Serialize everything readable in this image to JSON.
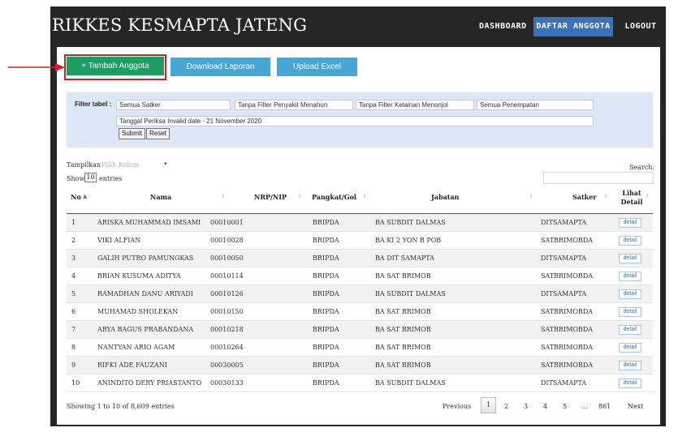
{
  "header": {
    "brand": "RIKKES KESMAPTA JATENG",
    "nav": {
      "dashboard": "DASHBOARD",
      "daftar_anggota": "DAFTAR ANGGOTA",
      "logout": "LOGOUT"
    }
  },
  "actions": {
    "tambah": "+ Tambah Anggota",
    "download": "Download Laporan",
    "upload": "Upload Excel"
  },
  "colors": {
    "accent": "#3a71b8",
    "add_button": "#1d9c63",
    "secondary_button": "#45a7d6",
    "highlight": "#e0182b"
  },
  "filters": {
    "label": "Filter tabel :",
    "satker": "Semua Satker",
    "penyakit": "Tanpa Filter Penyakit Menahun",
    "kelainan": "Tanpa Filter Kelainan Menonjol",
    "penempatan": "Semua Penempatan",
    "tanggal": "Tanggal Periksa Invalid date - 21 November 2020",
    "submit": "Submit",
    "reset": "Reset"
  },
  "controls": {
    "tampilkan": "Tampilkan",
    "pilih_kolom": "Pilih Kolom",
    "show": "Show",
    "page_length": "10",
    "entries": "entries",
    "search_label": "Search:"
  },
  "table": {
    "columns": {
      "no": "No",
      "nama": "Nama",
      "nrp": "NRP/NIP",
      "pangkat": "Pangkat/Gol",
      "jabatan": "Jabatan",
      "satker": "Satker",
      "detail": "Lihat Detail"
    },
    "detail_label": "detail",
    "rows": [
      {
        "no": "1",
        "nama": "ARISKA MUHAMMAD IMSAMI",
        "nrp": "00010001",
        "pangkat": "BRIPDA",
        "jabatan": "BA SUBDIT DALMAS",
        "satker": "DITSAMAPTA"
      },
      {
        "no": "2",
        "nama": "VIKI ALFIAN",
        "nrp": "00010028",
        "pangkat": "BRIPDA",
        "jabatan": "BA KI 2 YON B POB",
        "satker": "SATBRIMOBDA"
      },
      {
        "no": "3",
        "nama": "GALIH PUTRO PAMUNGKAS",
        "nrp": "00010050",
        "pangkat": "BRIPDA",
        "jabatan": "BA DIT SAMAPTA",
        "satker": "DITSAMAPTA"
      },
      {
        "no": "4",
        "nama": "BRIAN KUSUMA ADITYA",
        "nrp": "00010114",
        "pangkat": "BRIPDA",
        "jabatan": "BA SAT BRIMOB",
        "satker": "SATBRIMOBDA"
      },
      {
        "no": "5",
        "nama": "RAMADHAN DANU ARIYADI",
        "nrp": "00010126",
        "pangkat": "BRIPDA",
        "jabatan": "BA SUBDIT DALMAS",
        "satker": "DITSAMAPTA"
      },
      {
        "no": "6",
        "nama": "MUHAMAD SHOLEKAN",
        "nrp": "00010150",
        "pangkat": "BRIPDA",
        "jabatan": "BA SAT BRIMOB",
        "satker": "SATBRIMOBDA"
      },
      {
        "no": "7",
        "nama": "ARYA BAGUS PRABANDANA",
        "nrp": "00010218",
        "pangkat": "BRIPDA",
        "jabatan": "BA SAT BRIMOB",
        "satker": "SATBRIMOBDA"
      },
      {
        "no": "8",
        "nama": "NANTYAN ARIO AGAM",
        "nrp": "00010264",
        "pangkat": "BRIPDA",
        "jabatan": "BA SAT BRIMOB",
        "satker": "SATBRIMOBDA"
      },
      {
        "no": "9",
        "nama": "RIFKI ADE FAUZANI",
        "nrp": "00030005",
        "pangkat": "BRIPDA",
        "jabatan": "BA SAT BRIMOB",
        "satker": "SATBRIMOBDA"
      },
      {
        "no": "10",
        "nama": "ANINDITO DERY PRIASTANTO",
        "nrp": "00030133",
        "pangkat": "BRIPDA",
        "jabatan": "BA SUBDIT DALMAS",
        "satker": "DITSAMAPTA"
      }
    ]
  },
  "footer": {
    "showing": "Showing 1 to 10 of 8,609 entries",
    "previous": "Previous",
    "pages": [
      "1",
      "2",
      "3",
      "4",
      "5"
    ],
    "ellipsis": "...",
    "last_page": "861",
    "next": "Next"
  }
}
